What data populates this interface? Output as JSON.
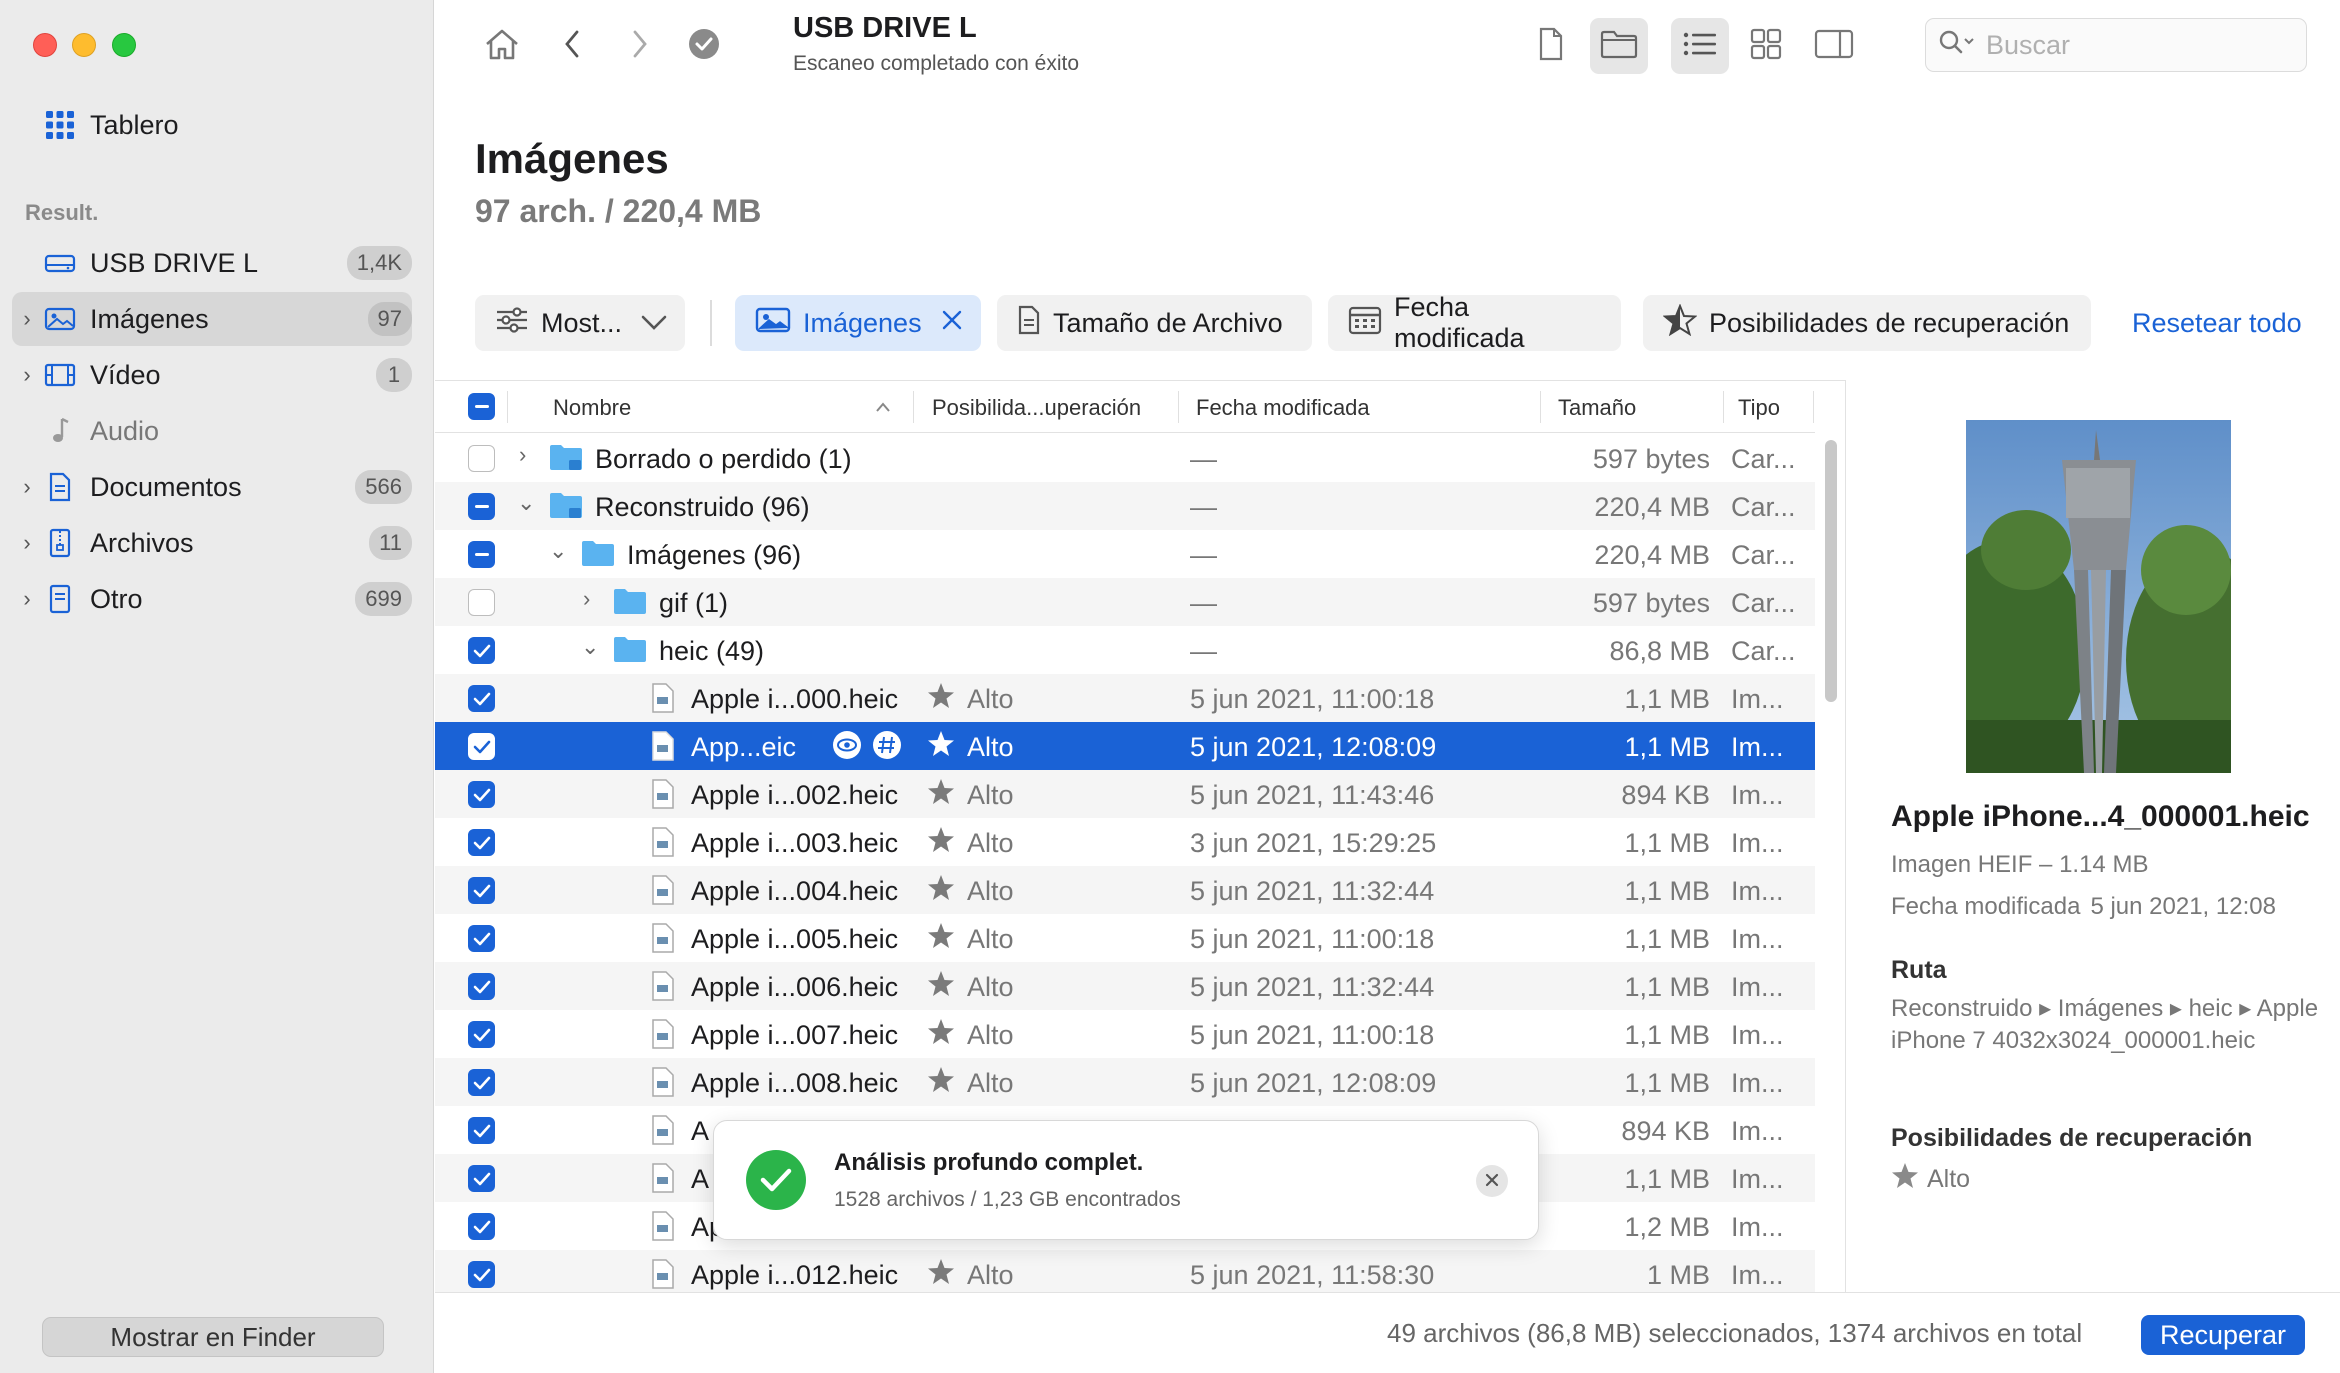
{
  "window": {
    "title": "USB DRIVE L",
    "subtitle": "Escaneo completado con éxito"
  },
  "search": {
    "placeholder": "Buscar",
    "value": ""
  },
  "sidebar": {
    "dashboard_label": "Tablero",
    "results_label": "Result.",
    "items": [
      {
        "label": "USB DRIVE L",
        "badge": "1,4K",
        "icon": "usb-drive-icon"
      },
      {
        "label": "Imágenes",
        "badge": "97",
        "icon": "image-icon",
        "selected": true
      },
      {
        "label": "Vídeo",
        "badge": "1",
        "icon": "film-icon"
      },
      {
        "label": "Audio",
        "badge": "",
        "icon": "music-note-icon"
      },
      {
        "label": "Documentos",
        "badge": "566",
        "icon": "document-icon"
      },
      {
        "label": "Archivos",
        "badge": "11",
        "icon": "archive-icon"
      },
      {
        "label": "Otro",
        "badge": "699",
        "icon": "other-file-icon"
      }
    ],
    "finder_button": "Mostrar en Finder"
  },
  "main": {
    "title": "Imágenes",
    "summary": "97 arch. / 220,4 MB"
  },
  "filters": {
    "show": "Most...",
    "images": "Imágenes",
    "file_size": "Tamaño de Archivo",
    "date_modified": "Fecha modificada",
    "recovery_chances": "Posibilidades de recuperación",
    "reset_all": "Resetear todo"
  },
  "table": {
    "columns": {
      "name": "Nombre",
      "chances": "Posibilida...uperación",
      "date": "Fecha modificada",
      "size": "Tamaño",
      "type": "Tipo"
    },
    "rows": [
      {
        "name": "Borrado o perdido (1)",
        "chances": "",
        "date": "—",
        "size": "597 bytes",
        "type": "Car..."
      },
      {
        "name": "Reconstruido (96)",
        "chances": "",
        "date": "—",
        "size": "220,4 MB",
        "type": "Car..."
      },
      {
        "name": "Imágenes (96)",
        "chances": "",
        "date": "—",
        "size": "220,4 MB",
        "type": "Car..."
      },
      {
        "name": "gif (1)",
        "chances": "",
        "date": "—",
        "size": "597 bytes",
        "type": "Car..."
      },
      {
        "name": "heic (49)",
        "chances": "",
        "date": "—",
        "size": "86,8 MB",
        "type": "Car..."
      },
      {
        "name": "Apple i...000.heic",
        "chances": "Alto",
        "date": "5 jun 2021, 11:00:18",
        "size": "1,1 MB",
        "type": "Im..."
      },
      {
        "name": "App...eic",
        "chances": "Alto",
        "date": "5 jun 2021, 12:08:09",
        "size": "1,1 MB",
        "type": "Im..."
      },
      {
        "name": "Apple i...002.heic",
        "chances": "Alto",
        "date": "5 jun 2021, 11:43:46",
        "size": "894 KB",
        "type": "Im..."
      },
      {
        "name": "Apple i...003.heic",
        "chances": "Alto",
        "date": "3 jun 2021, 15:29:25",
        "size": "1,1 MB",
        "type": "Im..."
      },
      {
        "name": "Apple i...004.heic",
        "chances": "Alto",
        "date": "5 jun 2021, 11:32:44",
        "size": "1,1 MB",
        "type": "Im..."
      },
      {
        "name": "Apple i...005.heic",
        "chances": "Alto",
        "date": "5 jun 2021, 11:00:18",
        "size": "1,1 MB",
        "type": "Im..."
      },
      {
        "name": "Apple i...006.heic",
        "chances": "Alto",
        "date": "5 jun 2021, 11:32:44",
        "size": "1,1 MB",
        "type": "Im..."
      },
      {
        "name": "Apple i...007.heic",
        "chances": "Alto",
        "date": "5 jun 2021, 11:00:18",
        "size": "1,1 MB",
        "type": "Im..."
      },
      {
        "name": "Apple i...008.heic",
        "chances": "Alto",
        "date": "5 jun 2021, 12:08:09",
        "size": "1,1 MB",
        "type": "Im..."
      },
      {
        "name": "A",
        "chances": "",
        "date": "",
        "size": "894 KB",
        "type": "Im..."
      },
      {
        "name": "A",
        "chances": "",
        "date": "",
        "size": "1,1 MB",
        "type": "Im..."
      },
      {
        "name": "Ap",
        "chances": "",
        "date": "",
        "size": "1,2 MB",
        "type": "Im..."
      },
      {
        "name": "Apple i...012.heic",
        "chances": "Alto",
        "date": "5 jun 2021, 11:58:30",
        "size": "1 MB",
        "type": "Im..."
      }
    ]
  },
  "toast": {
    "title": "Análisis profundo complet.",
    "subtitle": "1528 archivos / 1,23 GB encontrados"
  },
  "preview": {
    "name": "Apple iPhone...4_000001.heic",
    "type": "Imagen HEIF – 1.14 MB",
    "date_label": "Fecha modificada",
    "date_value": "5 jun 2021, 12:08",
    "path_label": "Ruta",
    "path": "Reconstruido ▸ Imágenes ▸ heic ▸ Apple iPhone 7 4032x3024_000001.heic",
    "recovery_label": "Posibilidades de recuperación",
    "recovery_value": "Alto"
  },
  "footer": {
    "status": "49 archivos (86,8 MB) seleccionados, 1374 archivos en total",
    "recover_button": "Recuperar"
  },
  "colors": {
    "accent": "#1a62d6",
    "success": "#2bb44a",
    "folder": "#5ab3f0"
  }
}
